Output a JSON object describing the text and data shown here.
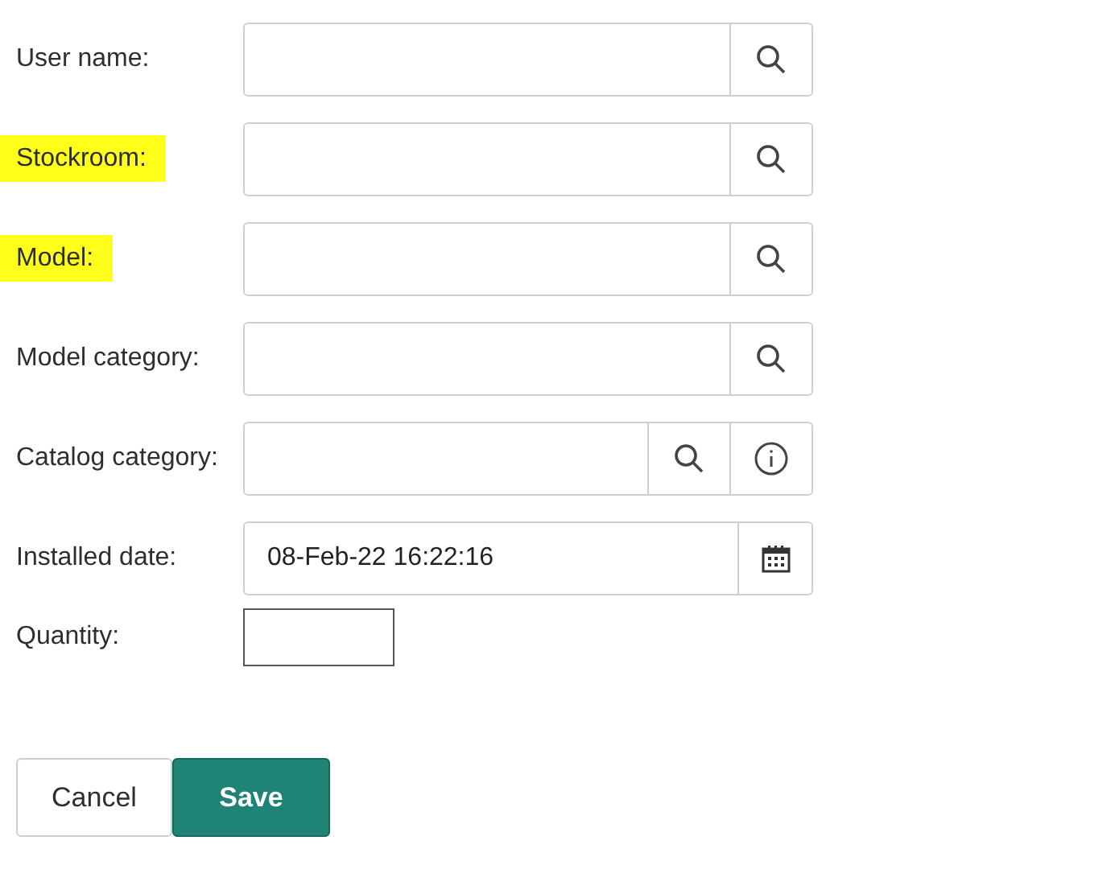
{
  "fields": [
    {
      "kind": "lookup",
      "label": "User name:",
      "highlighted": false
    },
    {
      "kind": "lookup",
      "label": "Stockroom:",
      "highlighted": true
    },
    {
      "kind": "lookup",
      "label": "Model:",
      "highlighted": true
    },
    {
      "kind": "lookup",
      "label": "Model category:",
      "highlighted": false
    },
    {
      "kind": "lookup_info",
      "label": "Catalog category:",
      "highlighted": false
    },
    {
      "kind": "date",
      "label": "Installed date:",
      "value": "08-Feb-22 16:22:16",
      "highlighted": false
    },
    {
      "kind": "number",
      "label": "Quantity:",
      "highlighted": false
    }
  ],
  "buttons": [
    {
      "kind": "secondary",
      "label": "Cancel"
    },
    {
      "kind": "primary",
      "label": "Save"
    }
  ]
}
